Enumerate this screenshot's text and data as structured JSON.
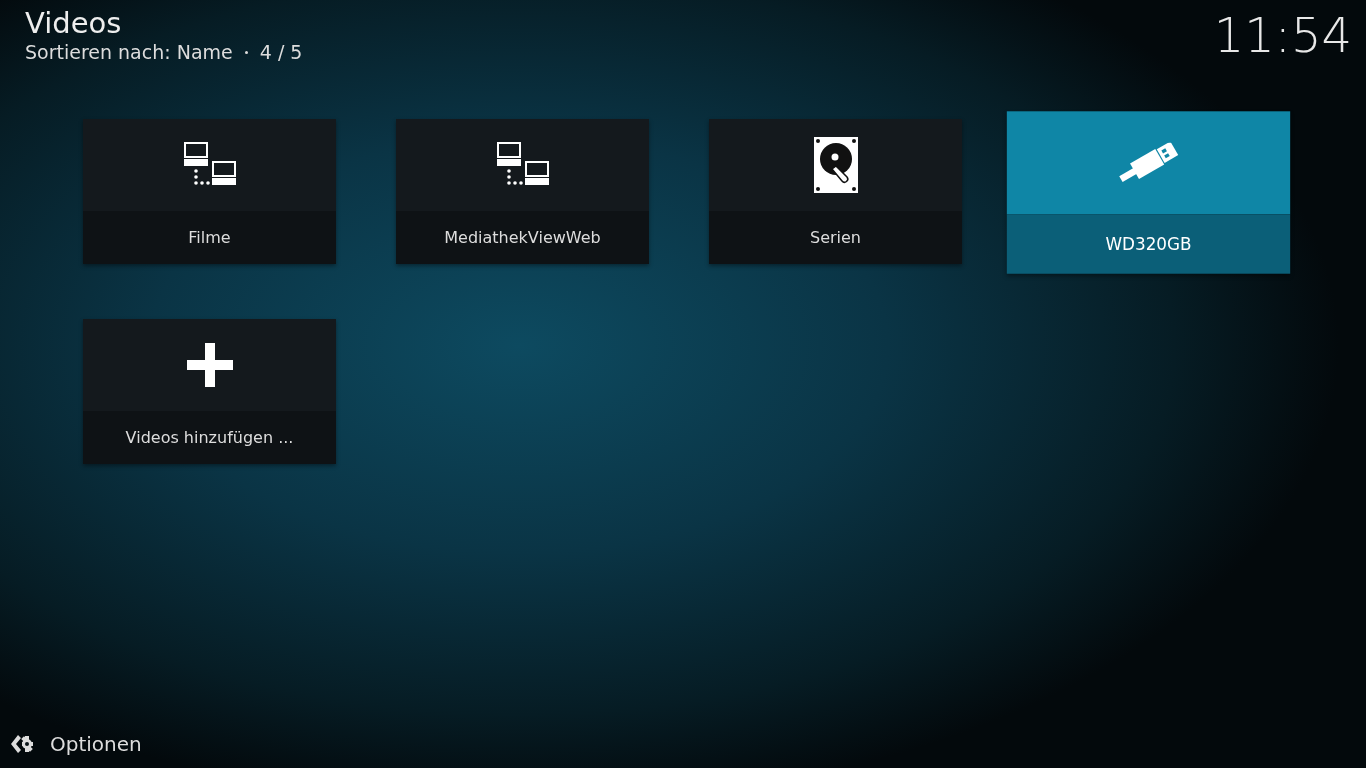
{
  "header": {
    "title": "Videos",
    "subtitle": "Sortieren nach: Name",
    "position": "4 / 5",
    "clock": "11:54"
  },
  "tiles": [
    {
      "label": "Filme",
      "kind": "network",
      "selected": false
    },
    {
      "label": "MediathekViewWeb",
      "kind": "network",
      "selected": false
    },
    {
      "label": "Serien",
      "kind": "harddisk",
      "selected": false
    },
    {
      "label": "WD320GB",
      "kind": "usb",
      "selected": true
    },
    {
      "label": "Videos hinzufügen ...",
      "kind": "add",
      "selected": false
    }
  ],
  "footer": {
    "options_label": "Optionen"
  }
}
